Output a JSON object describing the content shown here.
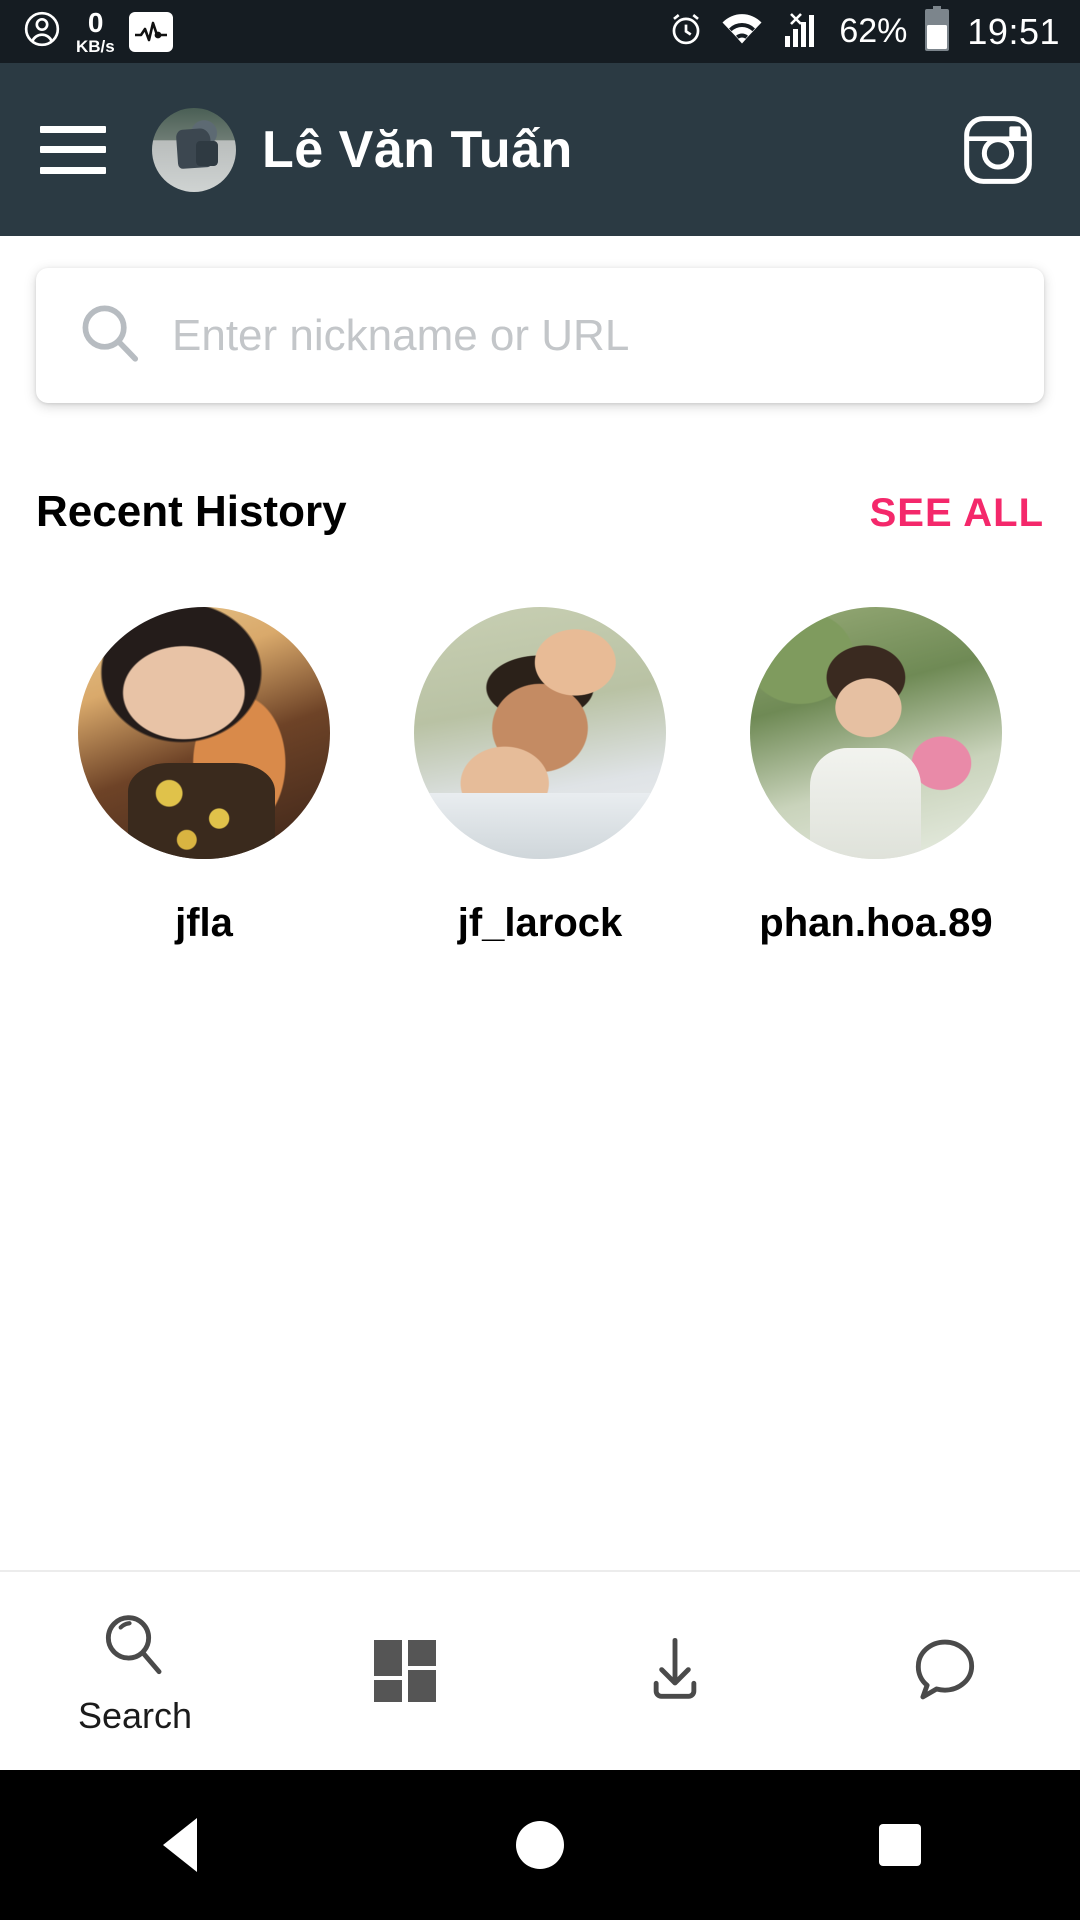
{
  "status_bar": {
    "network_speed_value": "0",
    "network_speed_unit": "KB/s",
    "person_icon": "person-icon",
    "pulse_icon": "pulse-monitor-icon",
    "alarm_icon": "alarm-clock-icon",
    "wifi_icon": "wifi-icon",
    "signal_icon": "cellular-signal-no-sim-icon",
    "battery_percent": "62%",
    "battery_icon": "battery-icon",
    "time": "19:51",
    "bg_color": "#151c22"
  },
  "app_bar": {
    "menu_icon": "hamburger-menu-icon",
    "profile_name": "Lê Văn Tuấn",
    "avatar": "user-avatar",
    "camera_icon": "instagram-camera-icon",
    "bg_color": "#2b3a43"
  },
  "search": {
    "placeholder": "Enter nickname or URL",
    "value": "",
    "icon": "search-icon"
  },
  "recent_history": {
    "title": "Recent History",
    "see_all_label": "SEE ALL",
    "see_all_color": "#f4286b",
    "items": [
      {
        "username": "jfla",
        "avatar_class": "ava-jfla"
      },
      {
        "username": "jf_larock",
        "avatar_class": "ava-larock"
      },
      {
        "username": "phan.hoa.89",
        "avatar_class": "ava-phan"
      }
    ]
  },
  "bottom_nav": {
    "items": [
      {
        "label": "Search",
        "icon": "search-icon",
        "selected": true
      },
      {
        "label": "",
        "icon": "grid-icon",
        "selected": false
      },
      {
        "label": "",
        "icon": "download-icon",
        "selected": false
      },
      {
        "label": "",
        "icon": "chat-bubble-icon",
        "selected": false
      }
    ]
  },
  "system_nav": {
    "back": "back-triangle-icon",
    "home": "home-circle-icon",
    "recents": "recents-square-icon"
  }
}
